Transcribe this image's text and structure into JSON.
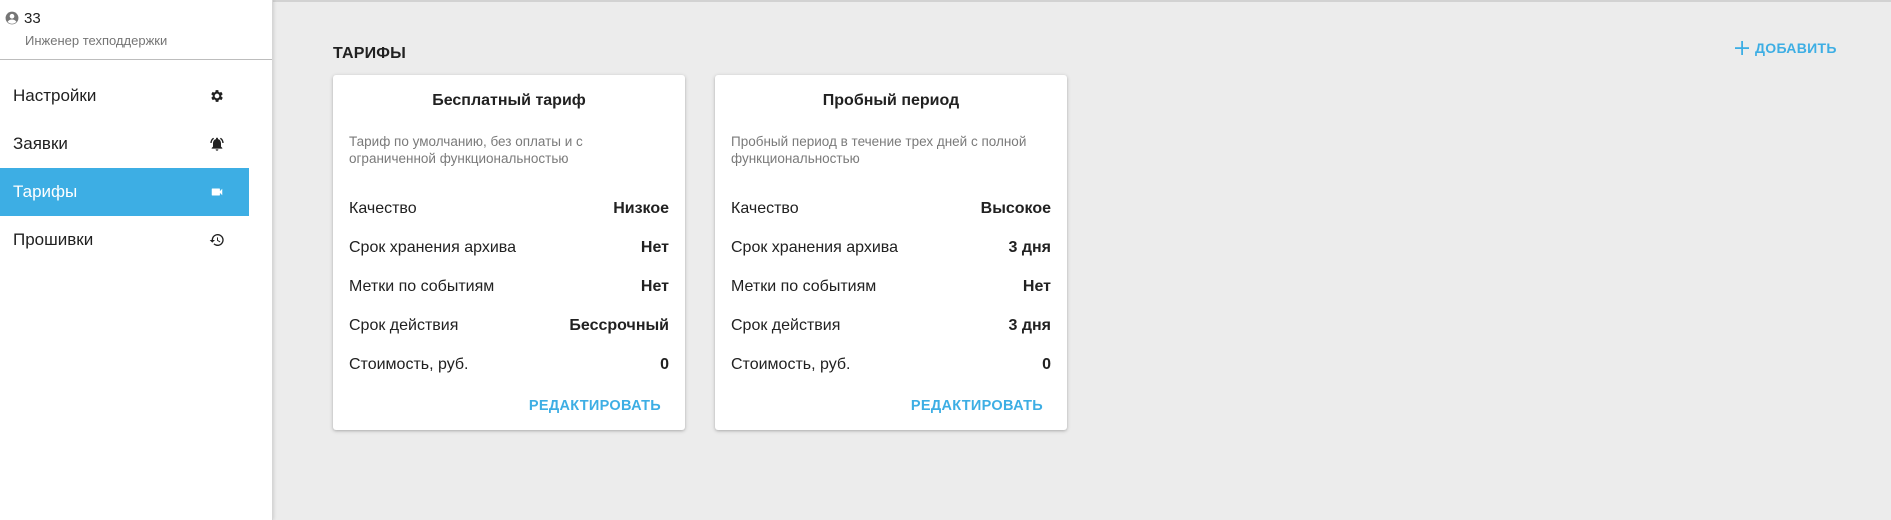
{
  "user": {
    "name": "33",
    "role": "Инженер техподдержки"
  },
  "sidebar": {
    "items": [
      {
        "label": "Настройки",
        "icon": "gear-icon"
      },
      {
        "label": "Заявки",
        "icon": "bell-alert-icon"
      },
      {
        "label": "Тарифы",
        "icon": "video-camera-icon",
        "active": true
      },
      {
        "label": "Прошивки",
        "icon": "history-icon"
      }
    ]
  },
  "main": {
    "section_title": "ТАРИФЫ",
    "add_label": "ДОБАВИТЬ"
  },
  "tariffs": [
    {
      "title": "Бесплатный тариф",
      "description": "Тариф по умолчанию, без оплаты и с ограниченной функциональностью",
      "specs": [
        {
          "label": "Качество",
          "value": "Низкое"
        },
        {
          "label": "Срок хранения архива",
          "value": "Нет"
        },
        {
          "label": "Метки по событиям",
          "value": "Нет"
        },
        {
          "label": "Срок действия",
          "value": "Бессрочный"
        },
        {
          "label": "Стоимость, руб.",
          "value": "0"
        }
      ],
      "action_label": "РЕДАКТИРОВАТЬ"
    },
    {
      "title": "Пробный период",
      "description": "Пробный период в течение трех дней с полной функциональностью",
      "specs": [
        {
          "label": "Качество",
          "value": "Высокое"
        },
        {
          "label": "Срок хранения архива",
          "value": "3 дня"
        },
        {
          "label": "Метки по событиям",
          "value": "Нет"
        },
        {
          "label": "Срок действия",
          "value": "3 дня"
        },
        {
          "label": "Стоимость, руб.",
          "value": "0"
        }
      ],
      "action_label": "РЕДАКТИРОВАТЬ"
    }
  ],
  "colors": {
    "accent": "#3daee4",
    "background": "#ececec",
    "text": "#212121",
    "muted": "#7a7a7a"
  }
}
